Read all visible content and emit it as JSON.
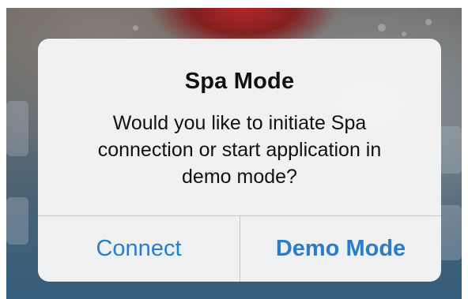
{
  "alert": {
    "title": "Spa Mode",
    "message": "Would you like to initiate Spa connection or start application in demo mode?",
    "buttons": {
      "connect_label": "Connect",
      "demo_label": "Demo Mode"
    }
  },
  "colors": {
    "button_text": "#2c7cc9",
    "alert_background": "#f5f5f6"
  }
}
